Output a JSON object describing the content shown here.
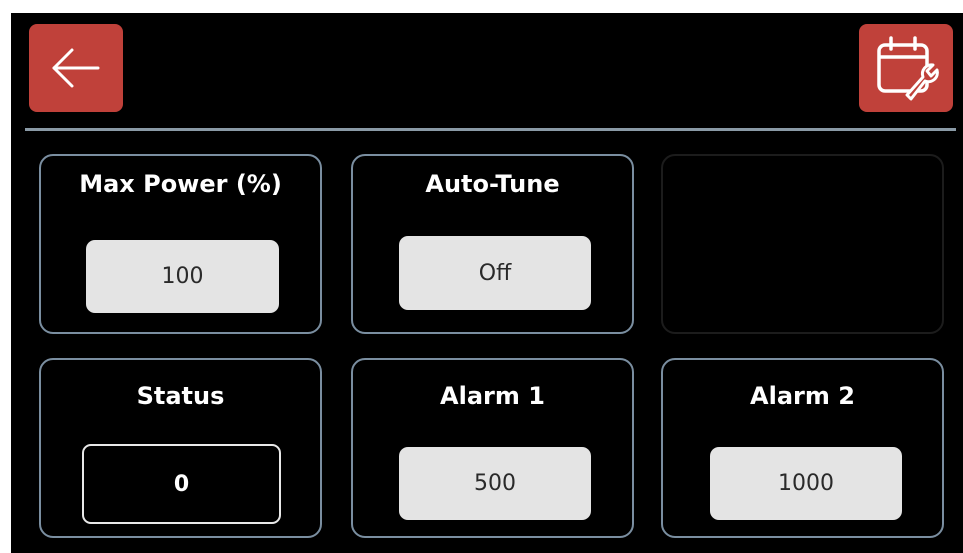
{
  "header": {
    "back_icon": "arrow-left-icon",
    "maintenance_icon": "calendar-wrench-icon",
    "accent_color": "#c0413a"
  },
  "cards": {
    "max_power": {
      "title": "Max Power (%)",
      "value": "100"
    },
    "auto_tune": {
      "title": "Auto-Tune",
      "value": "Off"
    },
    "status": {
      "title": "Status",
      "value": "0"
    },
    "alarm1": {
      "title": "Alarm 1",
      "value": "500"
    },
    "alarm2": {
      "title": "Alarm 2",
      "value": "1000"
    }
  }
}
